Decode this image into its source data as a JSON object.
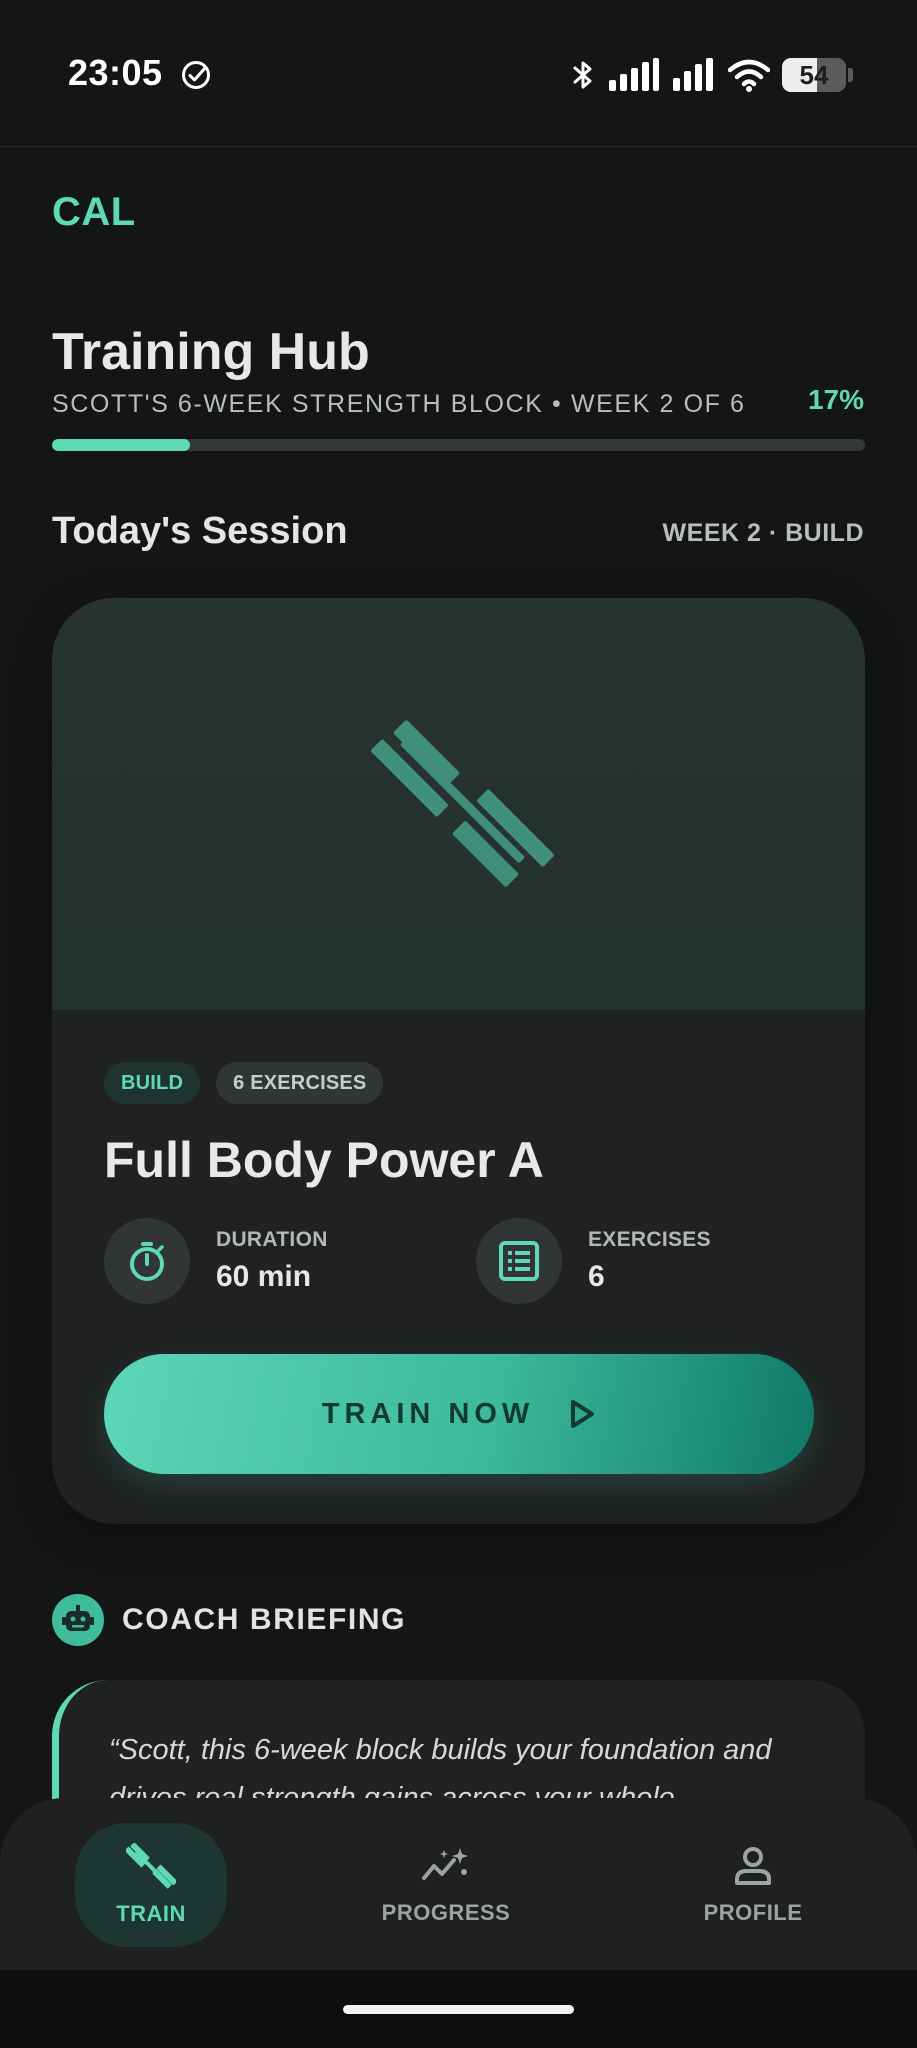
{
  "status_bar": {
    "time": "23:05",
    "battery": "54",
    "icons": [
      "check-circle-icon",
      "bluetooth-icon",
      "signal-icon",
      "signal-icon",
      "wifi-icon",
      "battery-icon"
    ]
  },
  "brand": "CAL",
  "hub": {
    "title": "Training Hub",
    "subtitle": "SCOTT'S 6-WEEK STRENGTH BLOCK • WEEK 2 OF 6",
    "progress_label": "17%",
    "progress_fraction": 0.17
  },
  "today": {
    "section_title": "Today's Session",
    "meta": "WEEK 2 · BUILD",
    "hero_icon": "dumbbell-icon",
    "tags": [
      "BUILD",
      "6 EXERCISES"
    ],
    "session_name": "Full Body Power A",
    "duration_label": "DURATION",
    "duration_value": "60 min",
    "exercises_label": "EXERCISES",
    "exercises_value": "6",
    "train_button_label": "TRAIN NOW"
  },
  "coach": {
    "title": "COACH BRIEFING",
    "quote": "“Scott, this 6-week block builds your foundation and drives real strength gains across your whole"
  },
  "nav": {
    "items": [
      {
        "label": "TRAIN",
        "icon": "dumbbell-icon",
        "active": true
      },
      {
        "label": "PROGRESS",
        "icon": "chart-sparkle-icon",
        "active": false
      },
      {
        "label": "PROFILE",
        "icon": "person-icon",
        "active": false
      }
    ]
  },
  "colors": {
    "accent": "#5fd8b6",
    "background": "#141616",
    "card": "#202222"
  }
}
